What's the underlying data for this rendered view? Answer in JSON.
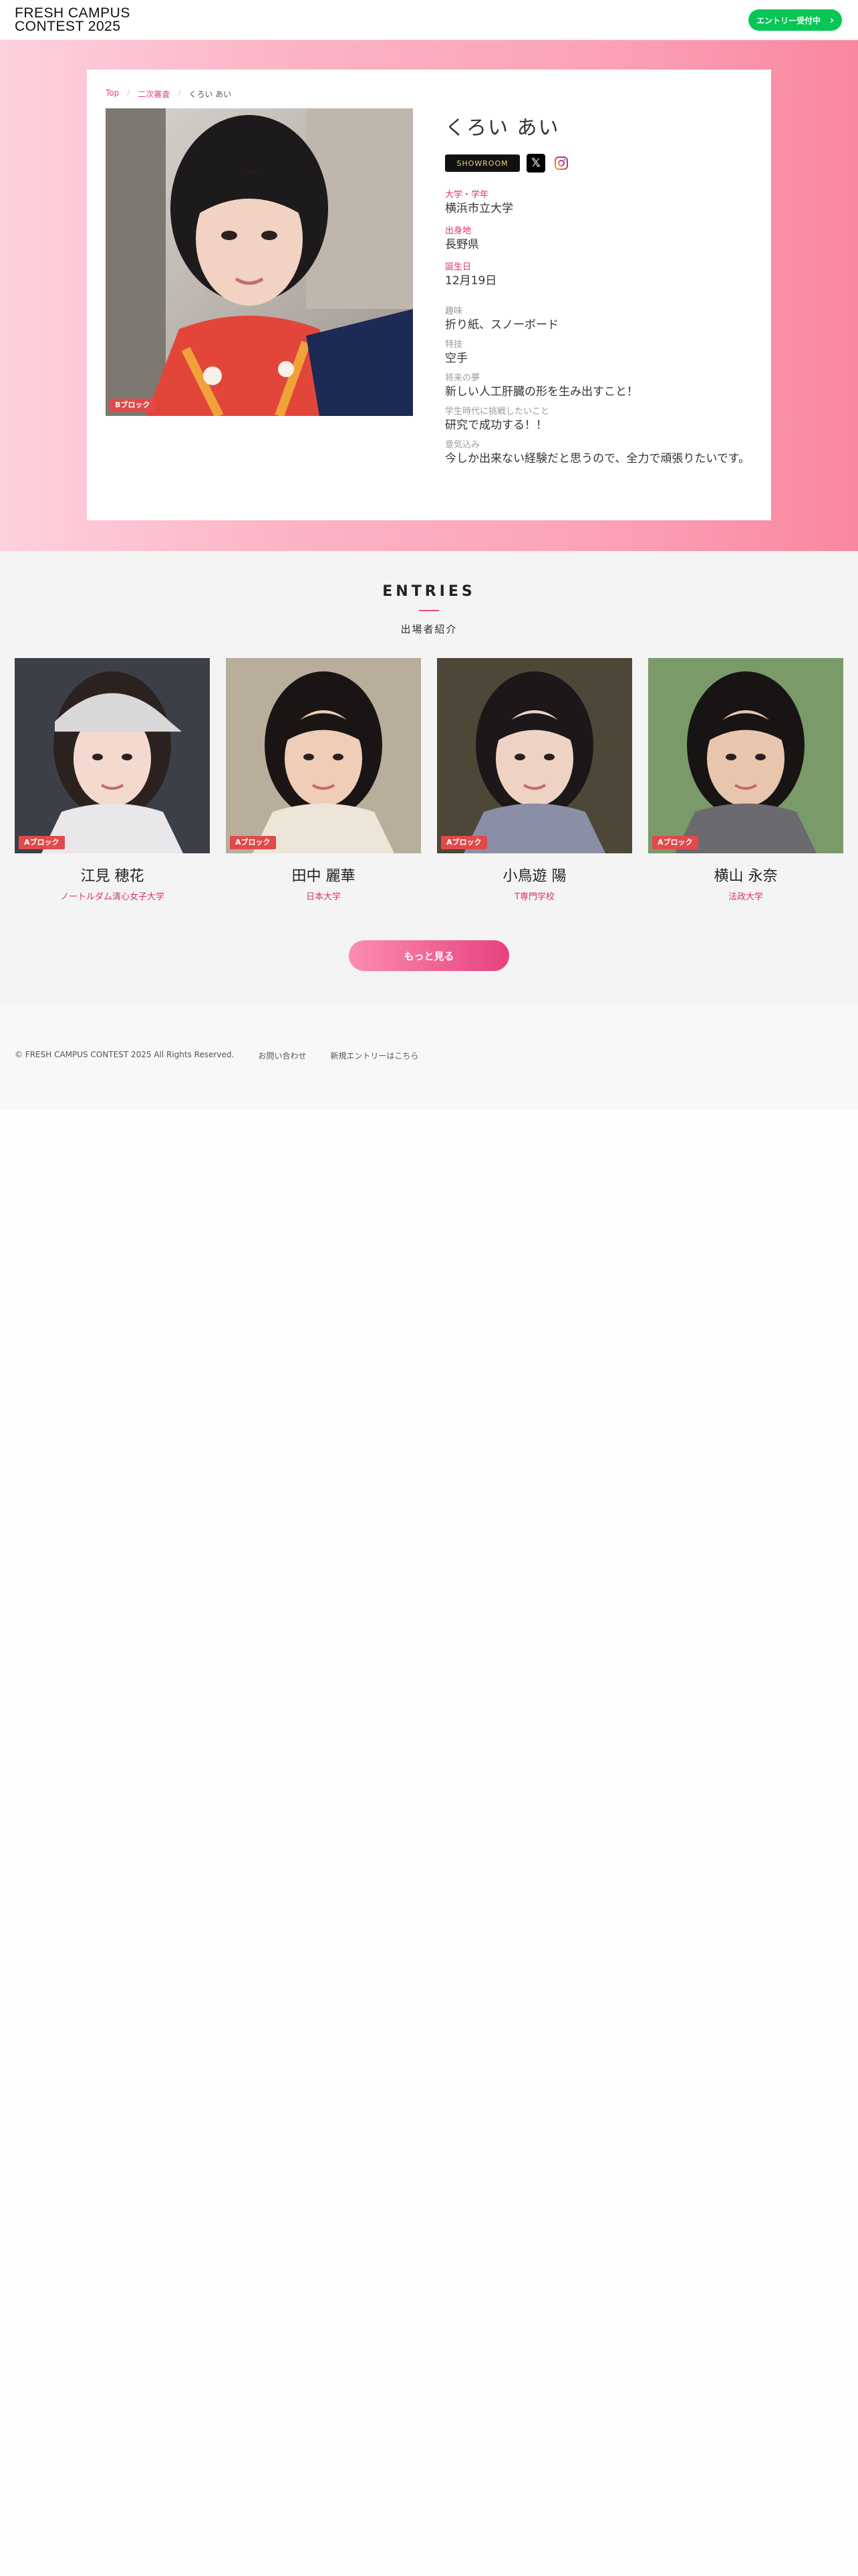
{
  "header": {
    "logo_line1": "FRESH CAMPUS",
    "logo_line2": "CONTEST 2025",
    "entry_button": "エントリー受付中",
    "entry_button_color": "#06c755"
  },
  "breadcrumb": {
    "top": "Top",
    "round": "二次審査",
    "current": "くろい あい"
  },
  "profile": {
    "name": "くろい あい",
    "block_badge": "Bブロック",
    "showroom_label": "SHOWROOM",
    "fields": [
      {
        "label": "大学・学年",
        "value": "横浜市立大学",
        "style": "pink"
      },
      {
        "label": "出身地",
        "value": "長野県",
        "style": "pink"
      },
      {
        "label": "誕生日",
        "value": "12月19日",
        "style": "pink"
      },
      {
        "label": "趣味",
        "value": "折り紙、スノーボード",
        "style": "grey"
      },
      {
        "label": "特技",
        "value": "空手",
        "style": "grey"
      },
      {
        "label": "将来の夢",
        "value": "新しい人工肝臓の形を生み出すこと！",
        "style": "grey"
      },
      {
        "label": "学生時代に挑戦したいこと",
        "value": "研究で成功する！！",
        "style": "grey"
      },
      {
        "label": "意気込み",
        "value": "今しか出来ない経験だと思うので、全力で頑張りたいです。",
        "style": "grey"
      }
    ]
  },
  "entries": {
    "title": "ENTRIES",
    "subtitle": "出場者紹介",
    "items": [
      {
        "name": "江見 穂花",
        "university": "ノートルダム清心女子大学",
        "badge": "Aブロック"
      },
      {
        "name": "田中 麗華",
        "university": "日本大学",
        "badge": "Aブロック"
      },
      {
        "name": "小鳥遊 陽",
        "university": "T専門学校",
        "badge": "Aブロック"
      },
      {
        "name": "横山 永奈",
        "university": "法政大学",
        "badge": "Aブロック"
      }
    ],
    "more_button": "もっと見る"
  },
  "footer": {
    "copyright": "© FRESH CAMPUS CONTEST 2025 All Rights Reserved.",
    "contact": "お問い合わせ",
    "new_entry": "新規エントリーはこちら"
  },
  "colors": {
    "accent_pink": "#e34a86",
    "badge_red": "#e04a4a"
  }
}
